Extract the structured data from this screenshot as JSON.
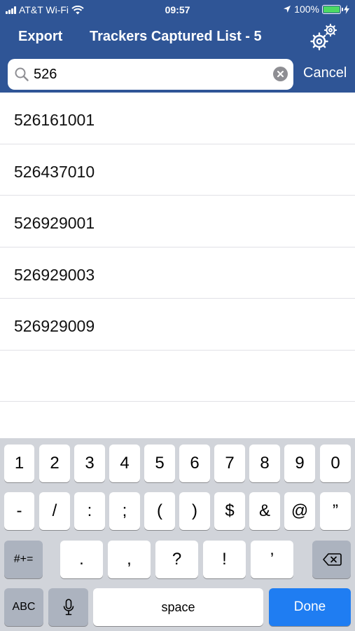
{
  "status_bar": {
    "carrier": "AT&T Wi-Fi",
    "time": "09:57",
    "battery": "100%"
  },
  "nav": {
    "export_label": "Export",
    "title": "Trackers Captured List - 5"
  },
  "search": {
    "value": "526",
    "cancel_label": "Cancel"
  },
  "results": [
    "526161001",
    "526437010",
    "526929001",
    "526929003",
    "526929009"
  ],
  "keyboard": {
    "row1": [
      "1",
      "2",
      "3",
      "4",
      "5",
      "6",
      "7",
      "8",
      "9",
      "0"
    ],
    "row2": [
      "-",
      "/",
      ":",
      ";",
      "(",
      ")",
      "$",
      "&",
      "@",
      "”"
    ],
    "row3": {
      "symbols": "#+=",
      "punct": [
        ".",
        ",",
        "?",
        "!",
        "’"
      ]
    },
    "bottom": {
      "abc": "ABC",
      "space": "space",
      "done": "Done"
    }
  },
  "colors": {
    "header": "#2f5596",
    "done_key": "#1f7df2",
    "keyboard_bg": "#d1d4da",
    "battery": "#4cd964"
  }
}
